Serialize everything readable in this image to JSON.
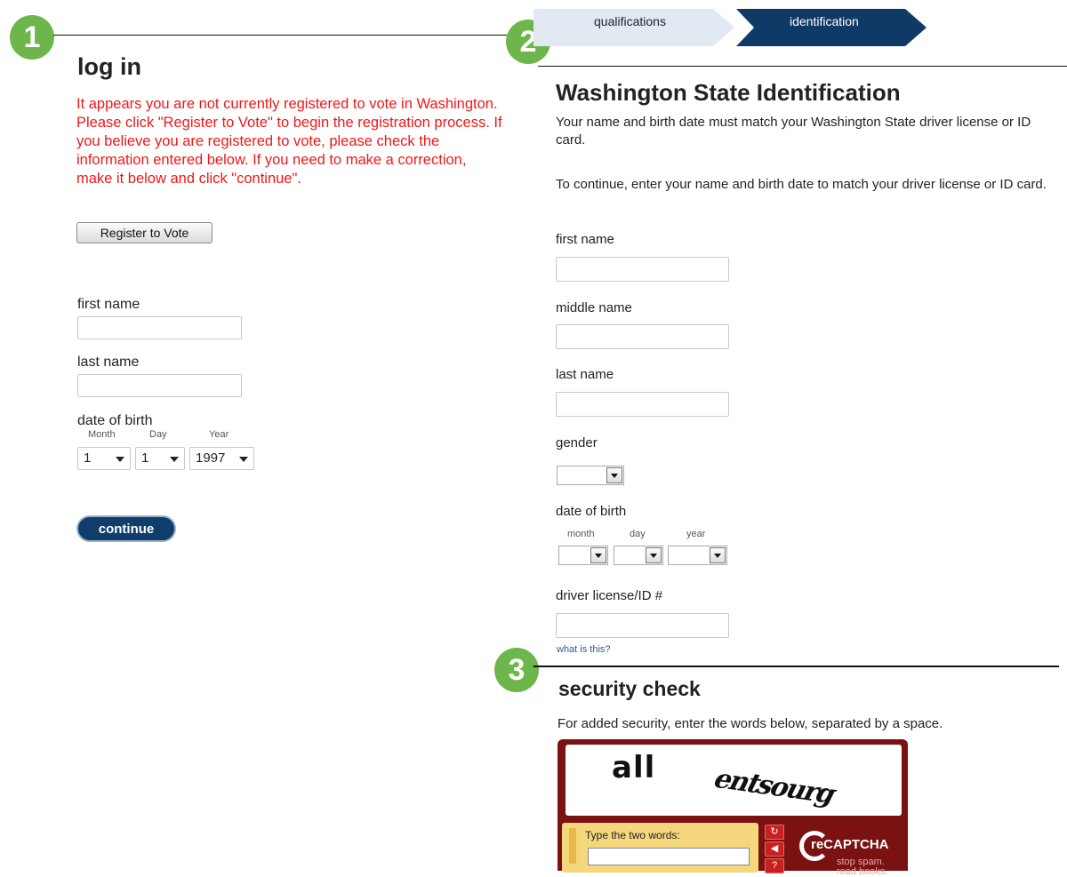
{
  "badges": [
    "1",
    "2",
    "3"
  ],
  "login": {
    "title": "log in",
    "error_message": "It appears you are not currently registered to vote in Washington. Please click \"Register to Vote\" to begin the registration process. If you believe you are registered to vote, please check the information entered below. If you need to make a correction, make it below and click \"continue\".",
    "register_button": "Register to Vote",
    "first_name_label": "first name",
    "first_name_value": "",
    "last_name_label": "last name",
    "last_name_value": "",
    "dob_label": "date of birth",
    "month_label": "Month",
    "day_label": "Day",
    "year_label": "Year",
    "month_value": "1",
    "day_value": "1",
    "year_value": "1997",
    "continue_button": "continue"
  },
  "steps": {
    "items": [
      "qualifications",
      "identification"
    ],
    "active": "identification",
    "active_color": "#0f3a66",
    "inactive_color": "#e1e9f3"
  },
  "identification": {
    "title": "Washington State Identification",
    "intro": "Your name and birth date must match your Washington State driver license or ID card.",
    "instruction": "To continue, enter your name and birth date to match your driver license or ID card.",
    "first_name_label": "first name",
    "middle_name_label": "middle name",
    "last_name_label": "last name",
    "gender_label": "gender",
    "gender_value": "",
    "dob_label": "date of birth",
    "month_label": "month",
    "day_label": "day",
    "year_label": "year",
    "license_label": "driver license/ID #",
    "what_is_this_link": "what is this?"
  },
  "security": {
    "title": "security check",
    "instruction": "For added security, enter the words below, separated by a space.",
    "captcha_words": [
      "all",
      "entsourg"
    ],
    "type_label": "Type the two words:",
    "logo_text": "reCAPTCHA",
    "tagline_1": "stop spam.",
    "tagline_2": "read books."
  },
  "colors": {
    "badge": "#6cb64b",
    "error": "#f01818",
    "navy": "#0f3e6d",
    "captcha_frame": "#7a1212"
  }
}
